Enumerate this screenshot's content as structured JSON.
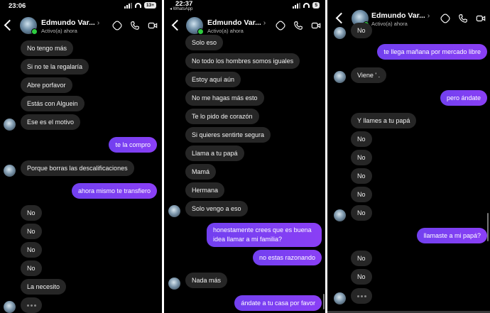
{
  "contact": {
    "name": "Edmundo Var...",
    "status": "Activo(a) ahora"
  },
  "panels": [
    {
      "status_time": "23:06",
      "status_sub": "",
      "battery": "13+",
      "messages": [
        {
          "dir": "in",
          "text": "No tengo más"
        },
        {
          "dir": "in",
          "text": "Si no te la regalaría"
        },
        {
          "dir": "in",
          "text": "Abre porfavor"
        },
        {
          "dir": "in",
          "text": "Estás con Alguein"
        },
        {
          "dir": "in",
          "text": "Ese es el motivo"
        },
        {
          "dir": "out",
          "text": "te la compro"
        },
        {
          "dir": "in",
          "text": "Porque borras las descalificaciones"
        },
        {
          "dir": "out",
          "text": "ahora mismo te transfiero"
        },
        {
          "dir": "in",
          "text": "No"
        },
        {
          "dir": "in",
          "text": "No"
        },
        {
          "dir": "in",
          "text": "No"
        },
        {
          "dir": "in",
          "text": "No"
        },
        {
          "dir": "in",
          "text": "La necesito"
        },
        {
          "dir": "in",
          "text": "•••"
        }
      ]
    },
    {
      "status_time": "22:37",
      "status_sub": "◂ WhatsApp",
      "battery": "5",
      "messages": [
        {
          "dir": "in",
          "text": "Solo eso"
        },
        {
          "dir": "in",
          "text": "No todo los hombres somos iguales"
        },
        {
          "dir": "in",
          "text": "Estoy aquí aún"
        },
        {
          "dir": "in",
          "text": "No me hagas más esto"
        },
        {
          "dir": "in",
          "text": "Te lo pido de corazón"
        },
        {
          "dir": "in",
          "text": "Si quieres sentirte segura"
        },
        {
          "dir": "in",
          "text": "Llama a tu papá"
        },
        {
          "dir": "in",
          "text": "Mamá"
        },
        {
          "dir": "in",
          "text": "Hermana"
        },
        {
          "dir": "in",
          "text": "Solo vengo a eso"
        },
        {
          "dir": "out",
          "text": "honestamente crees que es buena idea llamar a mi familia?"
        },
        {
          "dir": "out",
          "text": "no estas razonando"
        },
        {
          "dir": "in",
          "text": "Nada más"
        },
        {
          "dir": "out",
          "text": "ándate a tu casa por favor"
        }
      ]
    },
    {
      "messages": [
        {
          "dir": "in",
          "text": "No"
        },
        {
          "dir": "out",
          "text": "te llega mañana por mercado libre"
        },
        {
          "dir": "in",
          "text": "Viene ' ."
        },
        {
          "dir": "out",
          "text": "pero ándate"
        },
        {
          "dir": "in",
          "text": "Y llames a tu papá"
        },
        {
          "dir": "in",
          "text": "No"
        },
        {
          "dir": "in",
          "text": "No"
        },
        {
          "dir": "in",
          "text": "No"
        },
        {
          "dir": "in",
          "text": "No"
        },
        {
          "dir": "in",
          "text": "No"
        },
        {
          "dir": "out",
          "text": "llamaste a mi papá?"
        },
        {
          "dir": "in",
          "text": "No"
        },
        {
          "dir": "in",
          "text": "No"
        },
        {
          "dir": "in",
          "text": "•••"
        }
      ]
    }
  ],
  "icons": [
    "back-icon",
    "avatar",
    "sticker-icon",
    "phone-icon",
    "video-icon"
  ],
  "colors": {
    "incoming": "#262626",
    "outgoing": "#7b3ff2",
    "online": "#2ecc40"
  }
}
